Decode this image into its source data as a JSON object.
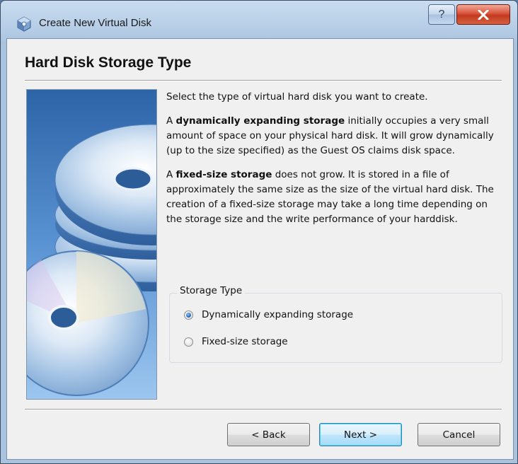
{
  "window": {
    "title": "Create New Virtual Disk",
    "help_glyph": "?",
    "close_icon": "close-x-icon",
    "app_icon": "virtualbox-cube-icon"
  },
  "page": {
    "heading": "Hard Disk Storage Type",
    "intro": "Select the type of virtual hard disk you want to create.",
    "dynamic_para": {
      "bold": "dynamically expanding storage",
      "prefix": "A ",
      "rest": " initially occupies a very small amount of space on your physical hard disk. It will grow dynamically (up to the size specified) as the Guest OS claims disk space."
    },
    "fixed_para": {
      "bold": "fixed-size storage",
      "prefix": "A ",
      "rest": " does not grow. It is stored in a file of approximately the same size as the size of the virtual hard disk. The creation of a fixed-size storage may take a long time depending on the storage size and the write performance of your harddisk."
    }
  },
  "storage_type": {
    "title": "Storage Type",
    "options": [
      {
        "label": "Dynamically expanding storage",
        "checked": true
      },
      {
        "label": "Fixed-size storage",
        "checked": false
      }
    ]
  },
  "buttons": {
    "back": "< Back",
    "next": "Next >",
    "cancel": "Cancel"
  },
  "colors": {
    "accent_default_button": "#3c7fb1",
    "close_button": "#c23a20",
    "side_image_blue": "#2f6db3"
  }
}
